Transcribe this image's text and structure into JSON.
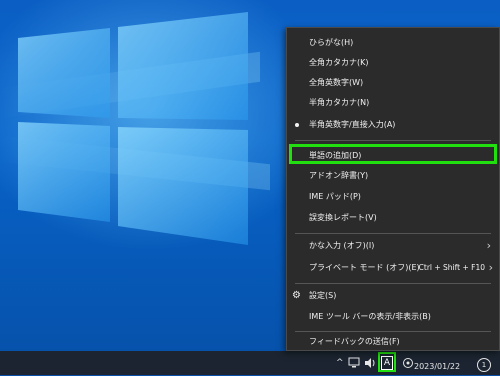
{
  "menu": {
    "items": [
      {
        "label": "ひらがな(H)"
      },
      {
        "label": "全角カタカナ(K)"
      },
      {
        "label": "全角英数字(W)"
      },
      {
        "label": "半角カタカナ(N)"
      },
      {
        "label": "半角英数字/直接入力(A)",
        "checked": true
      },
      {
        "label": "単語の追加(D)",
        "highlighted": true
      },
      {
        "label": "アドオン辞書(Y)"
      },
      {
        "label": "IME パッド(P)"
      },
      {
        "label": "誤変換レポート(V)"
      },
      {
        "label": "かな入力 (オフ)(I)",
        "submenu": true
      },
      {
        "label": "プライベート モード (オフ)(E)",
        "shortcut": "Ctrl + Shift + F10",
        "submenu": true
      },
      {
        "label": "設定(S)",
        "icon": "gear-icon"
      },
      {
        "label": "IME ツール バーの表示/非表示(B)"
      },
      {
        "label": "フィードバックの送信(F)"
      }
    ],
    "submenu_arrow": "›",
    "gear_glyph": "⚙"
  },
  "taskbar": {
    "ime_indicator": "A",
    "clock_date": "2023/01/22",
    "notification_count": "1"
  },
  "colors": {
    "highlight_border": "#22e00f",
    "menu_bg": "#2b2b2b"
  }
}
